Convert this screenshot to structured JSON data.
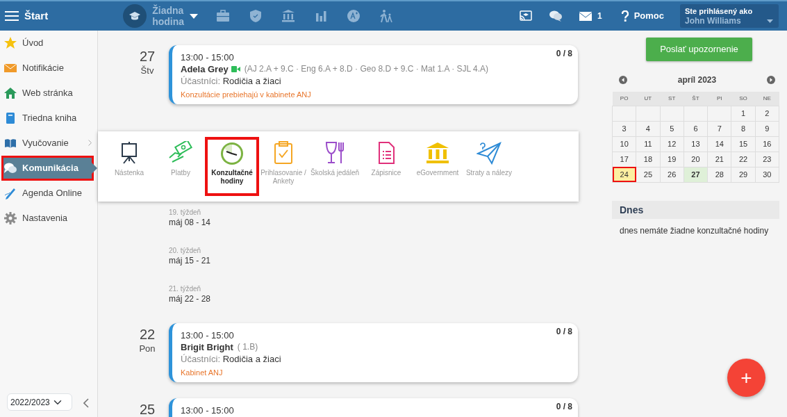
{
  "topbar": {
    "title": "Štart",
    "lesson": {
      "line1": "Žiadna",
      "line2": "hodina"
    },
    "mail_count": "1",
    "help": "Pomoc",
    "user": {
      "label": "Ste prihlásený ako",
      "name": "John Williams"
    }
  },
  "sidebar": {
    "items": [
      {
        "label": "Úvod",
        "selected": false,
        "expandable": false
      },
      {
        "label": "Notifikácie",
        "selected": false,
        "expandable": false
      },
      {
        "label": "Web stránka",
        "selected": false,
        "expandable": false
      },
      {
        "label": "Triedna kniha",
        "selected": false,
        "expandable": false
      },
      {
        "label": "Vyučovanie",
        "selected": false,
        "expandable": true
      },
      {
        "label": "Komunikácia",
        "selected": true,
        "expandable": false
      },
      {
        "label": "Agenda Online",
        "selected": false,
        "expandable": false
      },
      {
        "label": "Nastavenia",
        "selected": false,
        "expandable": false
      }
    ],
    "year": "2022/2023"
  },
  "timeline": [
    {
      "kind": "event",
      "day": "27",
      "weekday": "Štv",
      "time": "13:00 - 15:00",
      "name": "Adela Grey",
      "video": true,
      "classes": "(AJ 2.A + 9.C · Eng 6.A + 8.D · Geo 8.D + 9.C · Mat 1.A · SJL 4.A)",
      "participants_label": "Účastníci:",
      "participants": "Rodičia a žiaci",
      "note": "Konzultácie prebiehajú v kabinete ANJ",
      "count": "0 / 8"
    },
    {
      "kind": "bar"
    },
    {
      "kind": "week",
      "week": "19. týždeň",
      "range": "máj 08 - 14"
    },
    {
      "kind": "week",
      "week": "20. týždeň",
      "range": "máj 15 - 21"
    },
    {
      "kind": "week",
      "week": "21. týždeň",
      "range": "máj 22 - 28"
    },
    {
      "kind": "event",
      "day": "22",
      "weekday": "Pon",
      "time": "13:00 - 15:00",
      "name": "Brigit Bright",
      "video": false,
      "classes": "( 1.B)",
      "participants_label": "Účastníci:",
      "participants": "Rodičia a žiaci",
      "note": "Kabinet ANJ",
      "count": "0 / 8"
    },
    {
      "kind": "event",
      "day": "25",
      "time": "13:00 - 15:00",
      "video": false,
      "count": "0 / 8"
    }
  ],
  "menu": [
    {
      "label": "Nástenka",
      "selected": false
    },
    {
      "label": "Platby",
      "selected": false
    },
    {
      "label": "Konzultačné hodiny",
      "selected": true
    },
    {
      "label": "Prihlasovanie / Ankety",
      "selected": false
    },
    {
      "label": "Školská jedáleň",
      "selected": false
    },
    {
      "label": "Zápisnice",
      "selected": false
    },
    {
      "label": "eGovernment",
      "selected": false
    },
    {
      "label": "Straty a nálezy",
      "selected": false
    }
  ],
  "notify_button": "Poslať upozornenie",
  "calendar": {
    "title": "apríl 2023",
    "weekdays": [
      "PO",
      "UT",
      "ST",
      "ŠT",
      "PI",
      "SO",
      "NE"
    ],
    "weeks": [
      [
        {
          "label": "1",
          "kind": "plain"
        },
        {
          "label": "2",
          "kind": "plain"
        }
      ],
      [
        {
          "label": "3",
          "kind": "plain"
        },
        {
          "label": "4",
          "kind": "plain"
        },
        {
          "label": "5",
          "kind": "plain"
        },
        {
          "label": "6",
          "kind": "plain"
        },
        {
          "label": "7",
          "kind": "plain"
        },
        {
          "label": "8",
          "kind": "plain"
        },
        {
          "label": "9",
          "kind": "plain"
        }
      ],
      [
        {
          "label": "10",
          "kind": "plain"
        },
        {
          "label": "11",
          "kind": "plain"
        },
        {
          "label": "12",
          "kind": "plain"
        },
        {
          "label": "13",
          "kind": "plain"
        },
        {
          "label": "14",
          "kind": "plain"
        },
        {
          "label": "15",
          "kind": "plain"
        },
        {
          "label": "16",
          "kind": "plain"
        }
      ],
      [
        {
          "label": "17",
          "kind": "plain"
        },
        {
          "label": "18",
          "kind": "plain"
        },
        {
          "label": "19",
          "kind": "plain"
        },
        {
          "label": "20",
          "kind": "plain"
        },
        {
          "label": "21",
          "kind": "plain"
        },
        {
          "label": "22",
          "kind": "plain"
        },
        {
          "label": "23",
          "kind": "plain"
        }
      ],
      [
        {
          "label": "24",
          "kind": "today"
        },
        {
          "label": "25",
          "kind": "plain"
        },
        {
          "label": "26",
          "kind": "plain"
        },
        {
          "label": "27",
          "kind": "event"
        },
        {
          "label": "28",
          "kind": "plain"
        },
        {
          "label": "29",
          "kind": "plain"
        },
        {
          "label": "30",
          "kind": "plain"
        }
      ]
    ]
  },
  "today": {
    "title": "Dnes",
    "text": "dnes nemáte žiadne konzultačné hodiny"
  },
  "fab": "+"
}
